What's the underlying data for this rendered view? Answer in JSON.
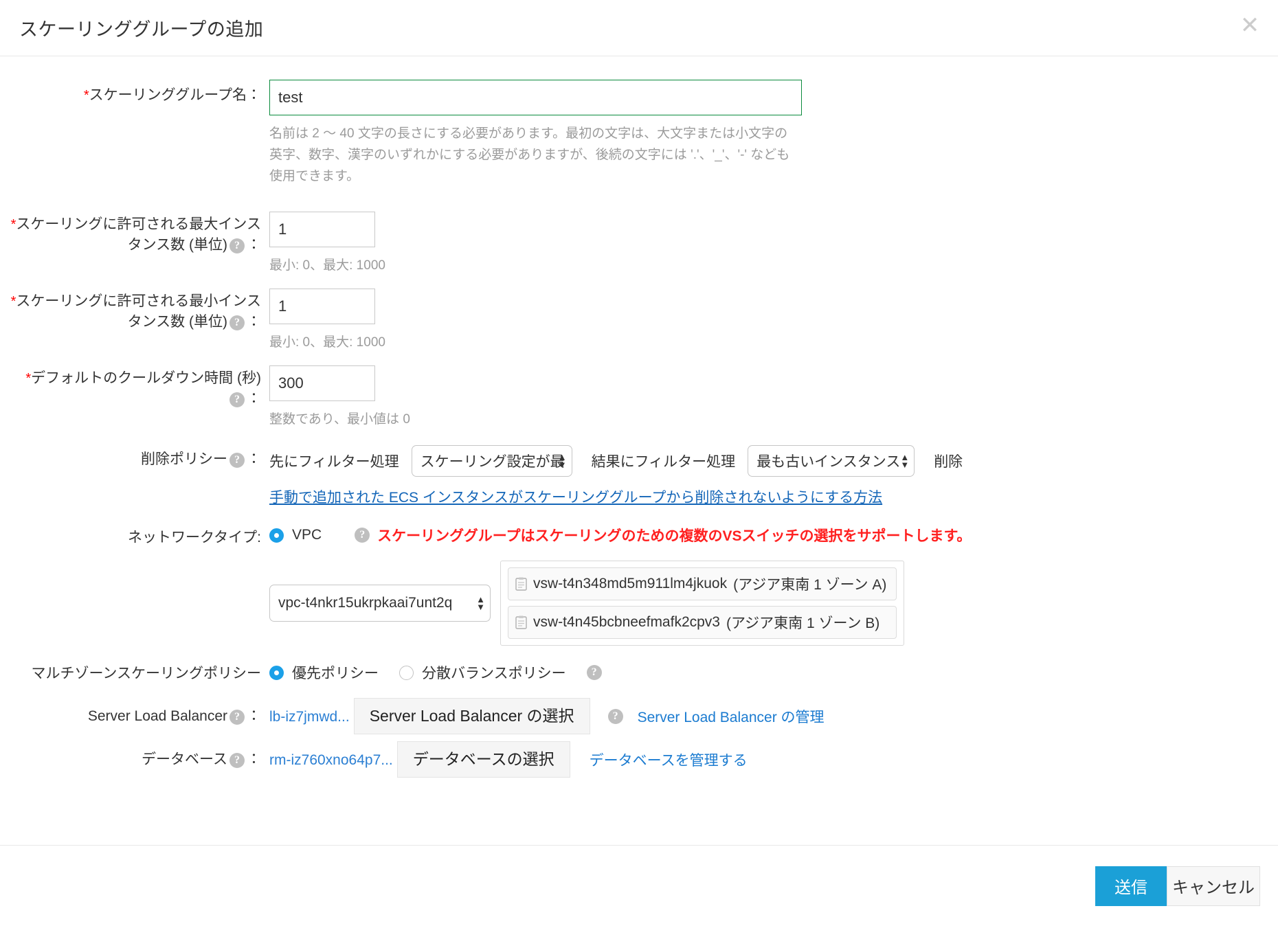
{
  "dialog": {
    "title": "スケーリンググループの追加",
    "close_icon": "close-icon"
  },
  "fields": {
    "group_name": {
      "label": "スケーリンググループ名：",
      "required_marker": "*",
      "value": "test",
      "hint": "名前は 2 ～ 40 文字の長さにする必要があります。最初の文字は、大文字または小文字の英字、数字、漢字のいずれかにする必要がありますが、後続の文字には '.'、'_'、'-' なども使用できます。"
    },
    "max_instances": {
      "label_line1": "スケーリングに許可される最大インス",
      "label_line2": "タンス数 (単位)",
      "label_suffix": "：",
      "required_marker": "*",
      "value": "1",
      "hint": "最小: 0、最大: 1000"
    },
    "min_instances": {
      "label_line1": "スケーリングに許可される最小インス",
      "label_line2": "タンス数 (単位)",
      "label_suffix": "：",
      "required_marker": "*",
      "value": "1",
      "hint": "最小: 0、最大: 1000"
    },
    "cooldown": {
      "label_line1": "デフォルトのクールダウン時間 (秒)",
      "label_suffix": "：",
      "required_marker": "*",
      "value": "300",
      "hint": "整数であり、最小値は 0"
    },
    "removal_policy": {
      "label": "削除ポリシー",
      "label_suffix": "：",
      "first_filter_text": "先にフィルター処理",
      "first_select_value": "スケーリング設定が最",
      "second_filter_text": "結果にフィルター処理",
      "second_select_value": "最も古いインスタンス",
      "delete_text": "削除",
      "link": "手動で追加された ECS インスタンスがスケーリンググループから削除されないようにする方法"
    },
    "network_type": {
      "label": "ネットワークタイプ:",
      "radio_vpc_label": "VPC",
      "radio_vpc_checked": true,
      "warning": "スケーリンググループはスケーリングのための複数のVSスイッチの選択をサポートします。",
      "vpc_select_value": "vpc-t4nkr15ukrpkaai7unt2q",
      "vswitches": [
        {
          "id": "vsw-t4n348md5m911lm4jkuok",
          "zone": "(アジア東南 1 ゾーン A)"
        },
        {
          "id": "vsw-t4n45bcbneefmafk2cpv3",
          "zone": "(アジア東南 1 ゾーン B)"
        }
      ]
    },
    "multizone_policy": {
      "label": "マルチゾーンスケーリングポリシー",
      "option_priority": "優先ポリシー",
      "option_balance": "分散バランスポリシー",
      "selected": "優先ポリシー"
    },
    "slb": {
      "label": "Server Load Balancer",
      "label_suffix": "：",
      "selected_value": "lb-iz7jmwd...",
      "select_button": "Server Load Balancer の選択",
      "manage_link": "Server Load Balancer の管理"
    },
    "database": {
      "label": "データベース",
      "label_suffix": "：",
      "selected_value": "rm-iz760xno64p7...",
      "select_button": "データベースの選択",
      "manage_link": "データベースを管理する"
    }
  },
  "footer": {
    "submit": "送信",
    "cancel": "キャンセル"
  },
  "colors": {
    "primary": "#1ba0d7",
    "link": "#1466b8",
    "warning": "#ff2020",
    "focus_border": "#0a8a3c"
  }
}
